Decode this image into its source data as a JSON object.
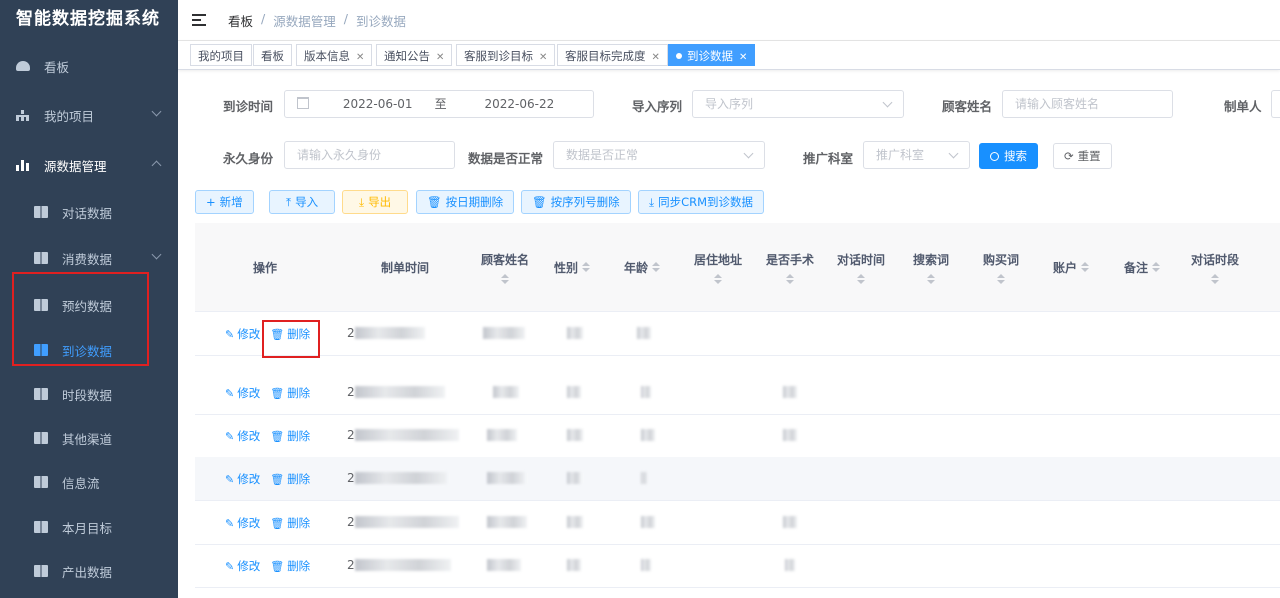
{
  "app": {
    "title": "智能数据挖掘系统"
  },
  "sidebar": {
    "items": [
      {
        "label": "看板",
        "icon": "dashboard-icon"
      },
      {
        "label": "我的项目",
        "icon": "tree-icon"
      },
      {
        "label": "源数据管理",
        "icon": "bar-chart-icon"
      },
      {
        "label": "对话数据",
        "icon": "book-icon"
      },
      {
        "label": "消费数据",
        "icon": "book-icon"
      },
      {
        "label": "预约数据",
        "icon": "book-icon"
      },
      {
        "label": "到诊数据",
        "icon": "book-icon"
      },
      {
        "label": "时段数据",
        "icon": "book-icon"
      },
      {
        "label": "其他渠道",
        "icon": "book-icon"
      },
      {
        "label": "信息流",
        "icon": "book-icon"
      },
      {
        "label": "本月目标",
        "icon": "book-icon"
      },
      {
        "label": "产出数据",
        "icon": "book-icon"
      }
    ]
  },
  "breadcrumb": {
    "items": [
      "看板",
      "源数据管理",
      "到诊数据"
    ],
    "sep": "/"
  },
  "tabs": [
    {
      "label": "我的项目"
    },
    {
      "label": "看板"
    },
    {
      "label": "版本信息"
    },
    {
      "label": "通知公告"
    },
    {
      "label": "客服到诊目标"
    },
    {
      "label": "客服目标完成度"
    },
    {
      "label": "到诊数据"
    }
  ],
  "filters": {
    "visit_time": {
      "label": "到诊时间",
      "start": "2022-06-01",
      "sep": "至",
      "end": "2022-06-22"
    },
    "import_seq": {
      "label": "导入序列",
      "placeholder": "导入序列"
    },
    "customer_name": {
      "label": "顾客姓名",
      "placeholder": "请输入顾客姓名"
    },
    "creator": {
      "label": "制单人"
    },
    "permanent_id": {
      "label": "永久身份",
      "placeholder": "请输入永久身份"
    },
    "data_normal": {
      "label": "数据是否正常",
      "placeholder": "数据是否正常"
    },
    "promo_dept": {
      "label": "推广科室",
      "placeholder": "推广科室"
    },
    "search_label": "搜索",
    "reset_label": "重置"
  },
  "toolbar": {
    "add": "新增",
    "import": "导入",
    "export": "导出",
    "delete_by_date": "按日期删除",
    "delete_by_seq": "按序列号删除",
    "sync_crm": "同步CRM到诊数据"
  },
  "table": {
    "columns": [
      "操作",
      "制单时间",
      "顾客姓名",
      "性别",
      "年龄",
      "居住地址",
      "是否手术",
      "对话时间",
      "搜索词",
      "购买词",
      "账户",
      "备注",
      "对话时段"
    ],
    "edit_label": "修改",
    "delete_label": "删除",
    "row_prefix": "2",
    "row_count": 6
  }
}
